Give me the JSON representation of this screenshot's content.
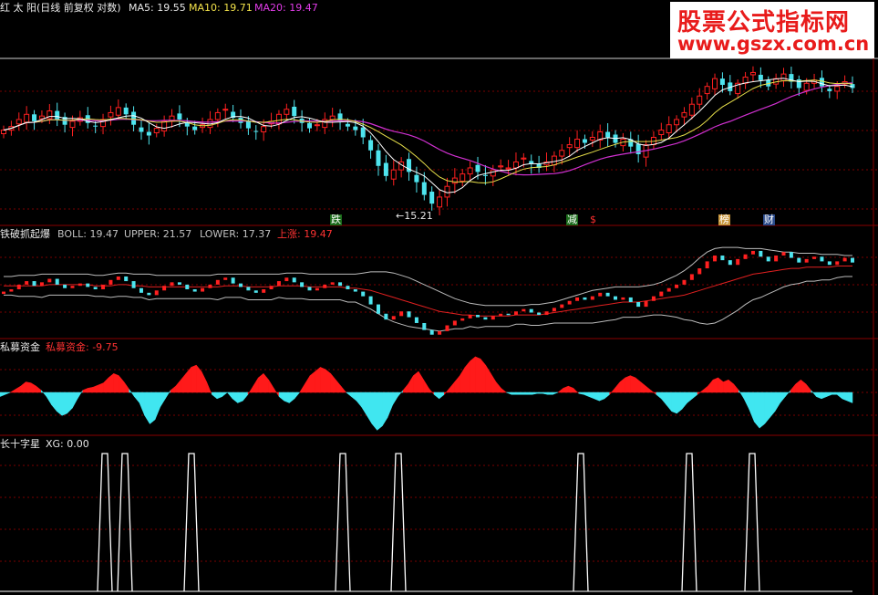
{
  "colors": {
    "up": "#ff2020",
    "down": "#4ee4ee",
    "ma5": "#ffffff",
    "ma10": "#e8e04a",
    "ma20": "#d030d0",
    "grid": "#7a0000",
    "divider": "#8a0000",
    "boll_band": "#bbbbbb",
    "boll_mid": "#e02020",
    "flow_pos": "#ff1a1a",
    "flow_neg": "#40e6f0",
    "xg_line": "#ffffff"
  },
  "main_header": {
    "name": "红 太 阳(日线 前复权 对数)",
    "ma5": "MA5: 19.55",
    "ma10": "MA10: 19.71",
    "ma20": "MA20: 19.47"
  },
  "boll_header": {
    "name": "铁破抓起爆",
    "boll": "BOLL: 19.47",
    "upper": "UPPER: 21.57",
    "lower": "LOWER: 17.37",
    "up": "上涨: 19.47"
  },
  "flow_header": {
    "name": "私募资金",
    "value": "私募资金: -9.75"
  },
  "xg_header": {
    "name": "长十字星",
    "value": "XG: 0.00"
  },
  "watermark": {
    "cn": "股票公式指标网",
    "url": "www.gszx.com.cn"
  },
  "markers": {
    "low_price": "←15.21",
    "tags": [
      "跌",
      "减",
      "$",
      "榜",
      "财"
    ]
  },
  "chart_data": [
    {
      "type": "candlestick",
      "title": "红 太 阳(日线 前复权 对数)",
      "series": [
        {
          "name": "MA5",
          "value": 19.55
        },
        {
          "name": "MA10",
          "value": 19.71
        },
        {
          "name": "MA20",
          "value": 19.47
        }
      ],
      "close": [
        19.3,
        19.5,
        19.9,
        20.2,
        19.8,
        20.1,
        20.4,
        19.9,
        19.6,
        19.8,
        20.0,
        19.7,
        19.5,
        19.9,
        20.3,
        20.6,
        20.2,
        19.6,
        19.2,
        19.0,
        19.4,
        19.8,
        20.1,
        19.9,
        19.5,
        19.3,
        19.6,
        19.9,
        20.3,
        20.5,
        20.0,
        19.7,
        19.4,
        19.2,
        19.5,
        19.8,
        20.2,
        20.5,
        20.1,
        19.7,
        19.4,
        19.6,
        19.9,
        20.1,
        19.8,
        19.5,
        19.3,
        18.9,
        18.2,
        17.4,
        16.9,
        17.2,
        17.6,
        17.1,
        16.6,
        16.0,
        15.6,
        15.9,
        16.4,
        16.8,
        17.0,
        17.3,
        17.1,
        16.9,
        17.2,
        17.4,
        17.3,
        17.6,
        17.8,
        17.5,
        17.3,
        17.6,
        17.9,
        18.2,
        18.5,
        18.8,
        18.6,
        18.9,
        19.2,
        18.9,
        18.6,
        18.8,
        18.4,
        18.0,
        18.5,
        18.9,
        19.3,
        19.6,
        19.9,
        20.3,
        20.8,
        21.3,
        21.9,
        22.4,
        22.0,
        21.6,
        22.1,
        22.5,
        22.8,
        22.3,
        21.9,
        22.4,
        22.7,
        22.2,
        21.8,
        22.1,
        22.3,
        21.9,
        21.6,
        21.9,
        22.2,
        21.8
      ],
      "low_label": "15.21",
      "ylim_note": "log scale"
    },
    {
      "type": "line",
      "title": "铁破抓起爆",
      "series": [
        {
          "name": "BOLL",
          "value": 19.47
        },
        {
          "name": "UPPER",
          "value": 21.57
        },
        {
          "name": "LOWER",
          "value": 17.37
        },
        {
          "name": "上涨",
          "value": 19.47
        }
      ],
      "boll_mid": [
        19.8,
        19.8,
        19.8,
        19.8,
        19.8,
        19.8,
        19.9,
        19.9,
        19.9,
        19.9,
        19.9,
        19.9,
        19.8,
        19.8,
        19.8,
        19.9,
        19.9,
        19.8,
        19.8,
        19.7,
        19.7,
        19.7,
        19.7,
        19.7,
        19.7,
        19.7,
        19.7,
        19.7,
        19.7,
        19.8,
        19.8,
        19.8,
        19.7,
        19.7,
        19.7,
        19.7,
        19.8,
        19.8,
        19.8,
        19.8,
        19.7,
        19.7,
        19.7,
        19.7,
        19.7,
        19.6,
        19.6,
        19.5,
        19.4,
        19.2,
        19.0,
        18.8,
        18.6,
        18.4,
        18.2,
        18.0,
        17.8,
        17.6,
        17.5,
        17.4,
        17.3,
        17.3,
        17.2,
        17.2,
        17.2,
        17.2,
        17.2,
        17.3,
        17.3,
        17.3,
        17.3,
        17.4,
        17.5,
        17.6,
        17.7,
        17.8,
        17.9,
        18.0,
        18.1,
        18.2,
        18.3,
        18.4,
        18.4,
        18.4,
        18.5,
        18.6,
        18.7,
        18.8,
        18.9,
        19.0,
        19.2,
        19.4,
        19.6,
        19.8,
        20.0,
        20.2,
        20.4,
        20.6,
        20.8,
        20.9,
        21.0,
        21.1,
        21.2,
        21.3,
        21.3,
        21.4,
        21.4,
        21.4,
        21.4,
        21.5,
        21.5,
        21.5
      ],
      "upper": [
        20.6,
        20.6,
        20.7,
        20.7,
        20.7,
        20.8,
        20.8,
        20.8,
        20.8,
        20.8,
        20.8,
        20.8,
        20.7,
        20.7,
        20.8,
        20.9,
        20.9,
        20.8,
        20.8,
        20.8,
        20.7,
        20.7,
        20.7,
        20.7,
        20.7,
        20.7,
        20.7,
        20.7,
        20.8,
        20.8,
        20.8,
        20.8,
        20.8,
        20.8,
        20.8,
        20.8,
        20.8,
        20.9,
        20.9,
        20.9,
        20.8,
        20.8,
        20.8,
        20.8,
        20.8,
        20.8,
        20.8,
        20.9,
        21.0,
        21.0,
        21.0,
        20.9,
        20.7,
        20.5,
        20.2,
        19.9,
        19.6,
        19.3,
        19.0,
        18.7,
        18.5,
        18.3,
        18.2,
        18.1,
        18.1,
        18.1,
        18.1,
        18.1,
        18.1,
        18.2,
        18.2,
        18.3,
        18.4,
        18.6,
        18.8,
        19.0,
        19.2,
        19.4,
        19.5,
        19.6,
        19.7,
        19.7,
        19.7,
        19.7,
        19.8,
        19.9,
        20.1,
        20.4,
        20.7,
        21.1,
        21.6,
        22.2,
        22.7,
        23.0,
        23.1,
        23.1,
        23.1,
        23.0,
        23.0,
        23.0,
        22.9,
        22.8,
        22.7,
        22.7,
        22.6,
        22.6,
        22.6,
        22.5,
        22.5,
        22.5,
        22.4,
        22.4
      ],
      "lower": [
        19.0,
        19.0,
        18.9,
        18.9,
        18.9,
        18.8,
        19.0,
        19.0,
        19.0,
        19.0,
        19.0,
        19.0,
        18.9,
        18.9,
        18.8,
        18.9,
        18.9,
        18.8,
        18.8,
        18.6,
        18.7,
        18.7,
        18.7,
        18.7,
        18.7,
        18.7,
        18.7,
        18.7,
        18.6,
        18.8,
        18.8,
        18.8,
        18.6,
        18.6,
        18.6,
        18.6,
        18.8,
        18.7,
        18.7,
        18.7,
        18.6,
        18.6,
        18.6,
        18.6,
        18.6,
        18.4,
        18.4,
        18.1,
        17.8,
        17.4,
        17.0,
        16.7,
        16.5,
        16.3,
        16.2,
        16.1,
        16.0,
        15.9,
        16.0,
        16.1,
        16.1,
        16.3,
        16.2,
        16.3,
        16.3,
        16.3,
        16.3,
        16.5,
        16.5,
        16.4,
        16.4,
        16.5,
        16.6,
        16.6,
        16.6,
        16.6,
        16.6,
        16.6,
        16.7,
        16.8,
        16.9,
        17.1,
        17.1,
        17.1,
        17.2,
        17.3,
        17.3,
        17.2,
        17.1,
        16.9,
        16.8,
        16.6,
        16.5,
        16.6,
        16.9,
        17.3,
        17.7,
        18.2,
        18.6,
        18.8,
        19.1,
        19.4,
        19.7,
        19.9,
        20.0,
        20.2,
        20.2,
        20.3,
        20.3,
        20.5,
        20.6,
        20.6
      ]
    },
    {
      "type": "area",
      "title": "私募资金",
      "series": [
        {
          "name": "私募资金",
          "value": -9.75
        }
      ],
      "values": [
        -4,
        -2,
        0,
        3,
        6,
        10,
        9,
        6,
        2,
        -4,
        -12,
        -18,
        -22,
        -20,
        -15,
        -6,
        2,
        4,
        5,
        7,
        9,
        14,
        18,
        16,
        10,
        3,
        -4,
        -10,
        -22,
        -30,
        -26,
        -14,
        -6,
        2,
        6,
        12,
        18,
        24,
        26,
        20,
        10,
        -2,
        -6,
        -4,
        0,
        -6,
        -10,
        -8,
        -2,
        6,
        14,
        18,
        12,
        4,
        -4,
        -8,
        -10,
        -6,
        0,
        8,
        16,
        20,
        24,
        22,
        18,
        12,
        6,
        0,
        -4,
        -8,
        -14,
        -22,
        -30,
        -36,
        -32,
        -24,
        -12,
        -4,
        2,
        8,
        16,
        20,
        12,
        4,
        -2,
        -6,
        -2,
        4,
        10,
        16,
        24,
        30,
        34,
        32,
        26,
        18,
        10,
        4,
        0,
        -2,
        -2,
        -2,
        -2,
        -2,
        -1,
        -1,
        -2,
        -2,
        0,
        4,
        6,
        4,
        -1,
        -2,
        -4,
        -6,
        -8,
        -6,
        -2,
        4,
        10,
        14,
        16,
        14,
        10,
        6,
        2,
        -2,
        -6,
        -12,
        -18,
        -20,
        -16,
        -10,
        -6,
        -2,
        2,
        6,
        12,
        14,
        10,
        12,
        8,
        2,
        -6,
        -16,
        -28,
        -34,
        -30,
        -24,
        -18,
        -10,
        -4,
        2,
        8,
        12,
        8,
        2,
        -4,
        -6,
        -4,
        -2,
        -2,
        -6,
        -8,
        -10
      ],
      "ylim": [
        -40,
        40
      ]
    },
    {
      "type": "line",
      "title": "长十字星",
      "series": [
        {
          "name": "XG",
          "value": 0.0
        }
      ],
      "spikes_at_px": "see script",
      "ylim": [
        0,
        1
      ]
    }
  ]
}
